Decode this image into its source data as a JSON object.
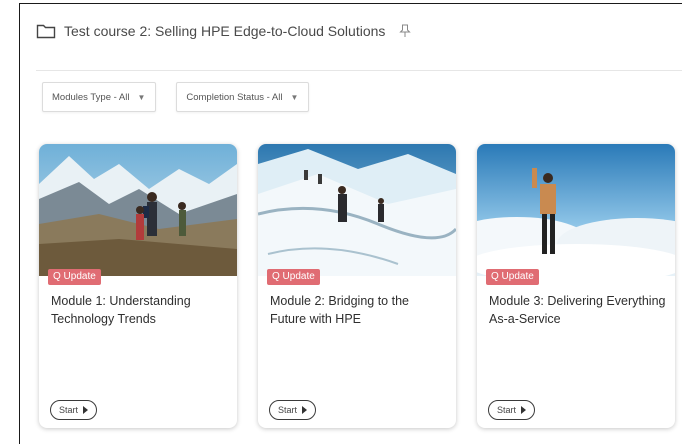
{
  "header": {
    "title": "Test course 2: Selling HPE Edge-to-Cloud Solutions",
    "folder_icon": "folder-icon",
    "pin_icon": "pin-icon"
  },
  "filters": [
    {
      "label": "Modules Type - All",
      "icon": "chevron-down-icon"
    },
    {
      "label": "Completion Status - All",
      "icon": "chevron-down-icon"
    }
  ],
  "modules": [
    {
      "badge": "Q Update",
      "title": "Module 1: Understanding Technology Trends",
      "start_label": "Start"
    },
    {
      "badge": "Q Update",
      "title": "Module 2: Bridging to the Future with HPE",
      "start_label": "Start"
    },
    {
      "badge": "Q Update",
      "title": "Module 3: Delivering Everything As-a-Service",
      "start_label": "Start"
    }
  ],
  "colors": {
    "badge": "#e06c73",
    "frame_border": "#1a1a1a",
    "text": "#2f2f2f"
  }
}
